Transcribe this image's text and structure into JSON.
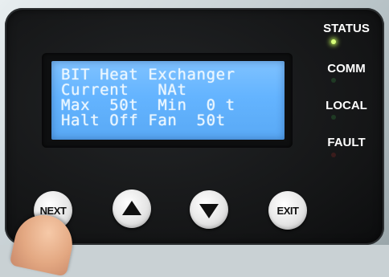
{
  "display": {
    "line1": "BIT Heat Exchanger",
    "line2": "Current   NAt",
    "line3": "Max  50t  Min  0 t",
    "line4": "Halt Off Fan  50t"
  },
  "indicators": {
    "status": "STATUS",
    "comm": "COMM",
    "local": "LOCAL",
    "fault": "FAULT"
  },
  "leds": {
    "status_color": "#d8ff7a",
    "comm_color": "#1f3a24",
    "local_color": "#1f3a24",
    "fault_color": "#3a1c1c"
  },
  "buttons": {
    "next_label": "NEXT",
    "up_icon": "triangle-up-icon",
    "down_icon": "triangle-down-icon",
    "exit_label": "EXIT"
  },
  "colors": {
    "lcd_background": "#64b4ff",
    "lcd_text": "#e9f6ff",
    "panel": "#161718"
  }
}
